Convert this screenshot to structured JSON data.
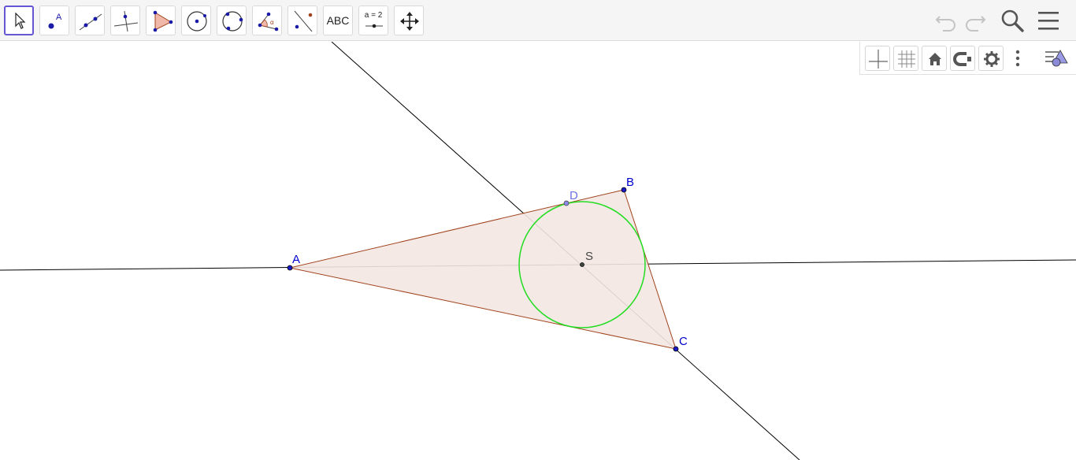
{
  "toolbar": {
    "tools": [
      {
        "name": "move-tool",
        "icon": "cursor-arrow-icon",
        "active": true
      },
      {
        "name": "point-tool",
        "icon": "point-icon",
        "label": "A"
      },
      {
        "name": "line-tool",
        "icon": "line-icon"
      },
      {
        "name": "perpendicular-line-tool",
        "icon": "perpendicular-line-icon"
      },
      {
        "name": "polygon-tool",
        "icon": "polygon-icon"
      },
      {
        "name": "circle-center-point-tool",
        "icon": "circle-center-icon"
      },
      {
        "name": "circle-three-points-tool",
        "icon": "circle-three-points-icon"
      },
      {
        "name": "angle-tool",
        "icon": "angle-icon",
        "label": "α"
      },
      {
        "name": "reflect-tool",
        "icon": "reflect-icon"
      },
      {
        "name": "text-tool",
        "icon": "text-icon",
        "label": "ABC"
      },
      {
        "name": "slider-tool",
        "icon": "slider-icon",
        "label": "a = 2"
      },
      {
        "name": "move-graphics-view-tool",
        "icon": "move-arrows-icon"
      }
    ],
    "right": [
      "undo-icon",
      "redo-icon",
      "search-icon",
      "menu-icon"
    ]
  },
  "style_bar": [
    "axes-icon",
    "grid-icon",
    "home-icon",
    "point-capturing-icon",
    "settings-icon",
    "more-vertical-icon",
    "style-bar-toggle-icon"
  ],
  "construction": {
    "points": [
      {
        "label": "A",
        "color": "#0000cc"
      },
      {
        "label": "B",
        "color": "#0000cc"
      },
      {
        "label": "C",
        "color": "#0000cc"
      },
      {
        "label": "D",
        "color": "#6f6fe0"
      },
      {
        "label": "S",
        "color": "#444444"
      }
    ],
    "triangle": {
      "vertices": [
        "A",
        "B",
        "C"
      ],
      "fill": "#f4e7e2",
      "stroke": "#a0431e"
    },
    "incircle": {
      "center": "S",
      "through": "D",
      "stroke": "#00dd00"
    },
    "bisector_color": "#000000"
  }
}
